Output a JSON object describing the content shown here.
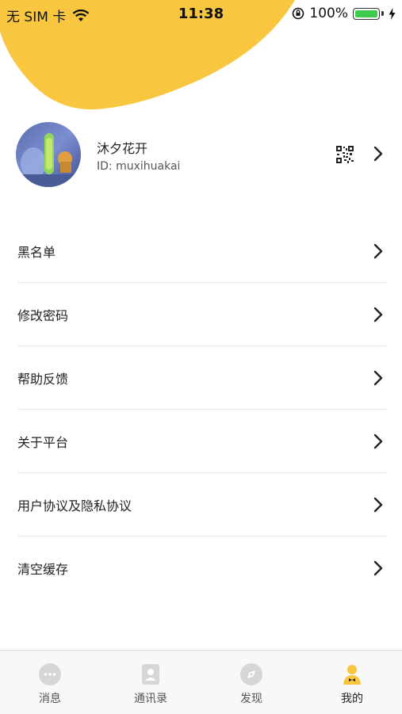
{
  "status_bar": {
    "carrier": "无 SIM 卡",
    "time": "11:38",
    "battery_percent": "100%",
    "icons": [
      "wifi-icon",
      "orientation-lock-icon",
      "battery-icon",
      "charging-icon"
    ]
  },
  "theme": {
    "accent": "#f8c73f",
    "text": "#222222",
    "divider": "#e7e7e7"
  },
  "profile": {
    "name": "沐夕花开",
    "id": "ID: muxihuakai",
    "icons": [
      "avatar",
      "qr-code-icon",
      "chevron-right-icon"
    ]
  },
  "menu": {
    "items": [
      {
        "label": "黑名单"
      },
      {
        "label": "修改密码"
      },
      {
        "label": "帮助反馈"
      },
      {
        "label": "关于平台"
      },
      {
        "label": "用户协议及隐私协议"
      },
      {
        "label": "清空缓存"
      }
    ]
  },
  "tabbar": {
    "tabs": [
      {
        "label": "消息",
        "icon": "message-icon",
        "active": false
      },
      {
        "label": "通讯录",
        "icon": "contacts-icon",
        "active": false
      },
      {
        "label": "发现",
        "icon": "discover-icon",
        "active": false
      },
      {
        "label": "我的",
        "icon": "profile-icon",
        "active": true
      }
    ]
  }
}
